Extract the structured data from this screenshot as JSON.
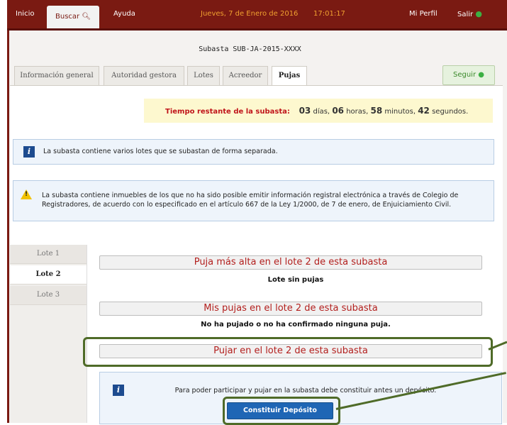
{
  "nav": {
    "home": "Inicio",
    "search": "Buscar",
    "help": "Ayuda",
    "date": "Jueves, 7 de Enero de 2016",
    "time": "17:01:17",
    "profile": "Mi Perfil",
    "logout": "Salir"
  },
  "auction": {
    "title": "Subasta SUB-JA-2015-XXXX"
  },
  "tabs": [
    "Información general",
    "Autoridad gestora",
    "Lotes",
    "Acreedor",
    "Pujas"
  ],
  "follow_label": "Seguir",
  "timer": {
    "label": "Tiempo restante de la subasta:",
    "days": "03",
    "days_unit": "días,",
    "hours": "06",
    "hours_unit": "horas,",
    "minutes": "58",
    "minutes_unit": "minutos,",
    "seconds": "42",
    "seconds_unit": "segundos."
  },
  "info_message": "La subasta contiene varios lotes que se subastan de forma separada.",
  "warning_message": "La subasta contiene inmuebles de los que no ha sido posible emitir información registral electrónica a través de Colegio de Registradores, de acuerdo con lo especificado en el artículo 667 de la Ley 1/2000, de 7 de enero, de Enjuiciamiento Civil.",
  "lots": [
    "Lote 1",
    "Lote 2",
    "Lote 3"
  ],
  "sections": {
    "highest_bid_title": "Puja más alta en el lote 2 de esta subasta",
    "highest_bid_value": "Lote sin pujas",
    "my_bids_title": "Mis pujas en el lote 2 de esta subasta",
    "my_bids_value": "No ha pujado o no ha confirmado ninguna puja.",
    "bid_title": "Pujar en el lote 2 de esta subasta"
  },
  "deposit": {
    "message": "Para poder participar y pujar en la subasta debe constituir antes un depósito.",
    "button": "Constituir Depósito"
  },
  "colors": {
    "brand": "#7a1a12",
    "accent_red": "#c0141a",
    "button_blue": "#1f66b5",
    "highlight": "#4f6b28"
  }
}
